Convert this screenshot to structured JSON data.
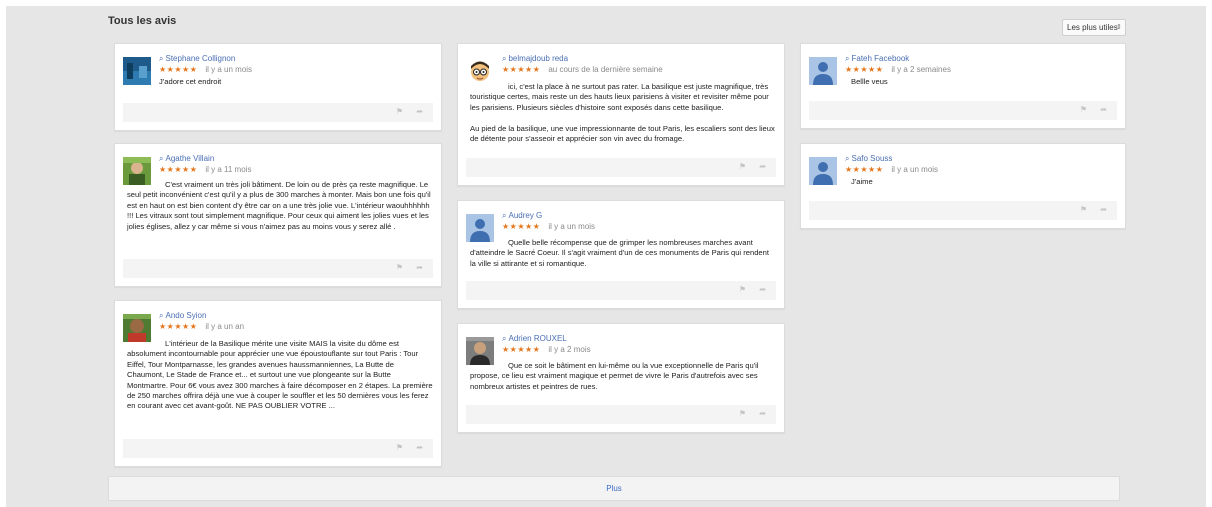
{
  "header": {
    "title": "Tous les avis"
  },
  "sort": {
    "label": "Les plus utiles",
    "arrows": "⇕"
  },
  "icons": {
    "search": "search-icon",
    "flag": "flag-icon",
    "share": "share-icon"
  },
  "colors": {
    "stars": "#e4771e",
    "link": "#4a6fb3",
    "background": "#e6e6e6"
  },
  "reviews": [
    {
      "author": "Stephane Collignon",
      "stars": "★★★★★",
      "rating": 5,
      "date": "il y a un mois",
      "text": "J'adore cet endroit"
    },
    {
      "author": "Agathe Villain",
      "stars": "★★★★★",
      "rating": 5,
      "date": "il y a 11 mois",
      "text": "C'est vraiment un très joli bâtiment. De loin ou de près ça reste magnifique. Le seul petit inconvénient c'est qu'il y a plus de 300 marches à monter. Mais bon une fois qu'il est en haut on est bien content d'y être car on a une très jolie vue. L'intérieur waouhhhhhh !!! Les vitraux sont tout simplement magnifique. Pour ceux qui aiment les jolies vues et les jolies églises, allez y car même si vous n'aimez pas au moins vous y serez allé ."
    },
    {
      "author": "Ando Syion",
      "stars": "★★★★★",
      "rating": 5,
      "date": "il y a un an",
      "text": "L'intérieur de la Basilique mérite une visite MAIS la visite du dôme est absolument incontournable pour apprécier une vue époustouflante sur tout Paris : Tour Eiffel, Tour Montparnasse, les grandes avenues haussmanniennes, La Butte de Chaumont, Le Stade de France et... et surtout une vue plongeante sur la Butte Montmartre. Pour 6€ vous avez 300 marches à faire décomposer en 2 étapes. La première de 250 marches offrira déjà une vue à couper le souffler et les 50 dernières vous les ferez en courant avec cet avant-goût. NE PAS OUBLIER VOTRE ..."
    },
    {
      "author": "belmajdoub reda",
      "stars": "★★★★★",
      "rating": 5,
      "date": "au cours de la dernière semaine",
      "text": "ici, c'est la place à ne surtout pas rater. La basilique est juste magnifique, très touristique certes, mais reste un des hauts lieux parisiens à visiter et revisiter même pour les parisiens. Plusieurs siècles d'histoire sont exposés dans cette basilique.",
      "text2": "Au pied de la basilique, une vue impressionnante de tout Paris, les escaliers sont des lieux de détente pour s'asseoir et apprécier son vin avec du fromage."
    },
    {
      "author": "Audrey G",
      "stars": "★★★★★",
      "rating": 5,
      "date": "il y a un mois",
      "text": "Quelle belle récompense que de grimper les nombreuses marches avant d'atteindre le Sacré Coeur. Il s'agit vraiment d'un de ces monuments de Paris qui rendent la ville si attirante et si romantique."
    },
    {
      "author": "Adrien ROUXEL",
      "stars": "★★★★★",
      "rating": 5,
      "date": "il y a 2 mois",
      "text": "Que ce soit le bâtiment en lui-même ou la vue exceptionnelle de Paris qu'il propose, ce lieu est vraiment magique et permet de vivre le Paris d'autrefois avec ses nombreux artistes et peintres de rues."
    },
    {
      "author": "Fateh Facebook",
      "stars": "★★★★★",
      "rating": 5,
      "date": "il y a 2 semaines",
      "text": "Bellle veus"
    },
    {
      "author": "Safo Souss",
      "stars": "★★★★★",
      "rating": 5,
      "date": "il y a un mois",
      "text": "J'aime"
    }
  ],
  "footer_icons": {
    "flag": "⚑",
    "share": "➦"
  },
  "more": {
    "label": "Plus"
  }
}
